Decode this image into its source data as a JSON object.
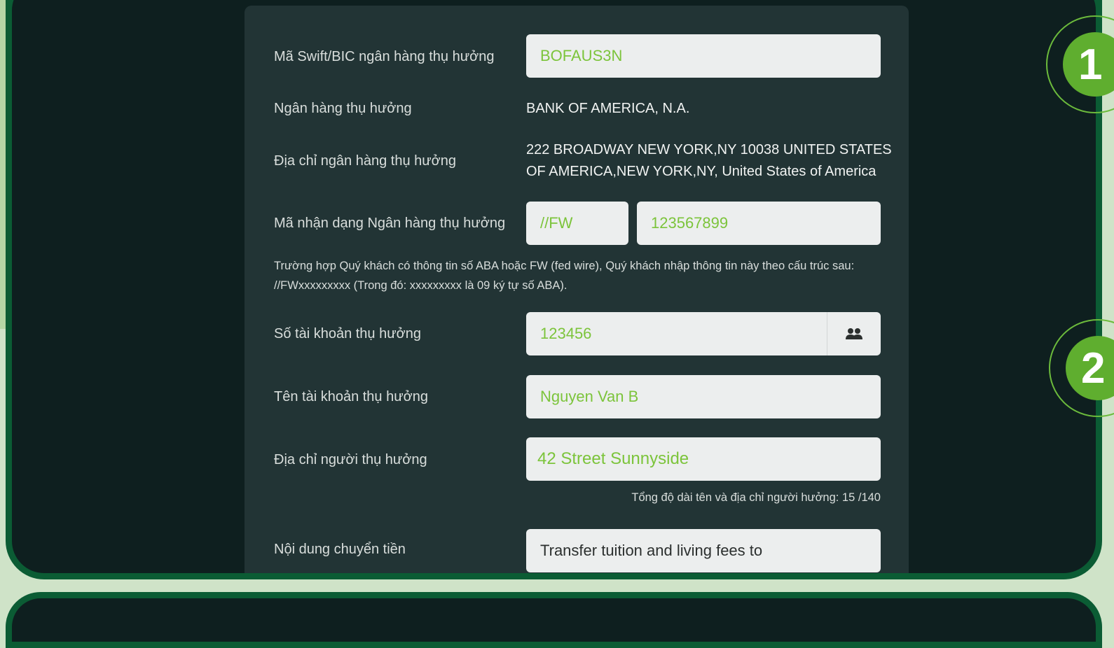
{
  "form": {
    "swift": {
      "label": "Mã Swift/BIC ngân hàng thụ hưởng",
      "value": "BOFAUS3N"
    },
    "bank_name": {
      "label": "Ngân hàng thụ hưởng",
      "value": "BANK OF AMERICA, N.A."
    },
    "bank_address": {
      "label": "Địa chỉ ngân hàng thụ hưởng",
      "line1": "222 BROADWAY NEW YORK,NY 10038 UNITED STATES",
      "line2": "OF AMERICA,NEW YORK,NY, United States of America"
    },
    "bank_id": {
      "label": "Mã nhận dạng Ngân hàng thụ hưởng",
      "prefix": "//FW",
      "code": "123567899"
    },
    "aba_note": {
      "line1": "Trường hợp Quý khách có thông tin số ABA hoặc FW (fed wire), Quý khách nhập thông tin này theo cấu trúc sau:",
      "line2": "//FWxxxxxxxxx (Trong đó: xxxxxxxxx là 09 ký tự số ABA)."
    },
    "account_number": {
      "label": "Số tài khoản thụ hưởng",
      "value": "123456"
    },
    "account_name": {
      "label": "Tên tài khoản thụ hưởng",
      "value": "Nguyen Van B"
    },
    "beneficiary_address": {
      "label": "Địa chỉ người thụ hưởng",
      "value": "42 Street Sunnyside"
    },
    "length_counter": "Tổng độ dài tên và địa chỉ người hưởng: 15 /140",
    "transfer_content": {
      "label": "Nội dung chuyển tiền",
      "value": "Transfer tuition and living fees to"
    }
  },
  "steps": [
    "1",
    "2"
  ],
  "colors": {
    "accent_green": "#7cc43b",
    "frame_green": "#0b5c34",
    "panel_bg": "#0e1f1f",
    "card_bg": "#223435"
  }
}
